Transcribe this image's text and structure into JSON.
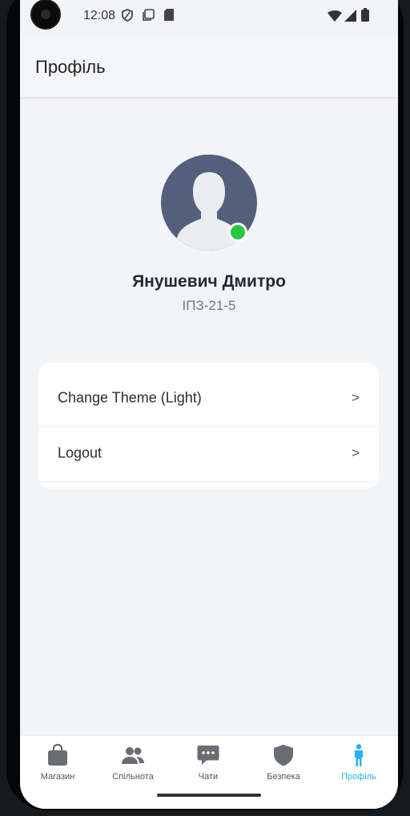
{
  "status_bar": {
    "time": "12:08"
  },
  "app_bar": {
    "title": "Профіль"
  },
  "profile": {
    "name": "Янушевич Дмитро",
    "group": "ІПЗ-21-5",
    "online": true
  },
  "menu": {
    "items": [
      {
        "label": "Change Theme (Light)",
        "chevron": ">"
      },
      {
        "label": "Logout",
        "chevron": ">"
      }
    ]
  },
  "bottom_nav": {
    "items": [
      {
        "label": "Магазин",
        "icon": "shopping-bag-icon",
        "active": false
      },
      {
        "label": "Спільнота",
        "icon": "people-icon",
        "active": false
      },
      {
        "label": "Чати",
        "icon": "chat-bubble-icon",
        "active": false
      },
      {
        "label": "Безпека",
        "icon": "shield-icon",
        "active": false
      },
      {
        "label": "Профіль",
        "icon": "person-icon",
        "active": true
      }
    ]
  },
  "colors": {
    "accent": "#2ab0f0",
    "online": "#28c840",
    "avatar_bg": "#545f7e",
    "nav_icon": "#6b6d74"
  }
}
